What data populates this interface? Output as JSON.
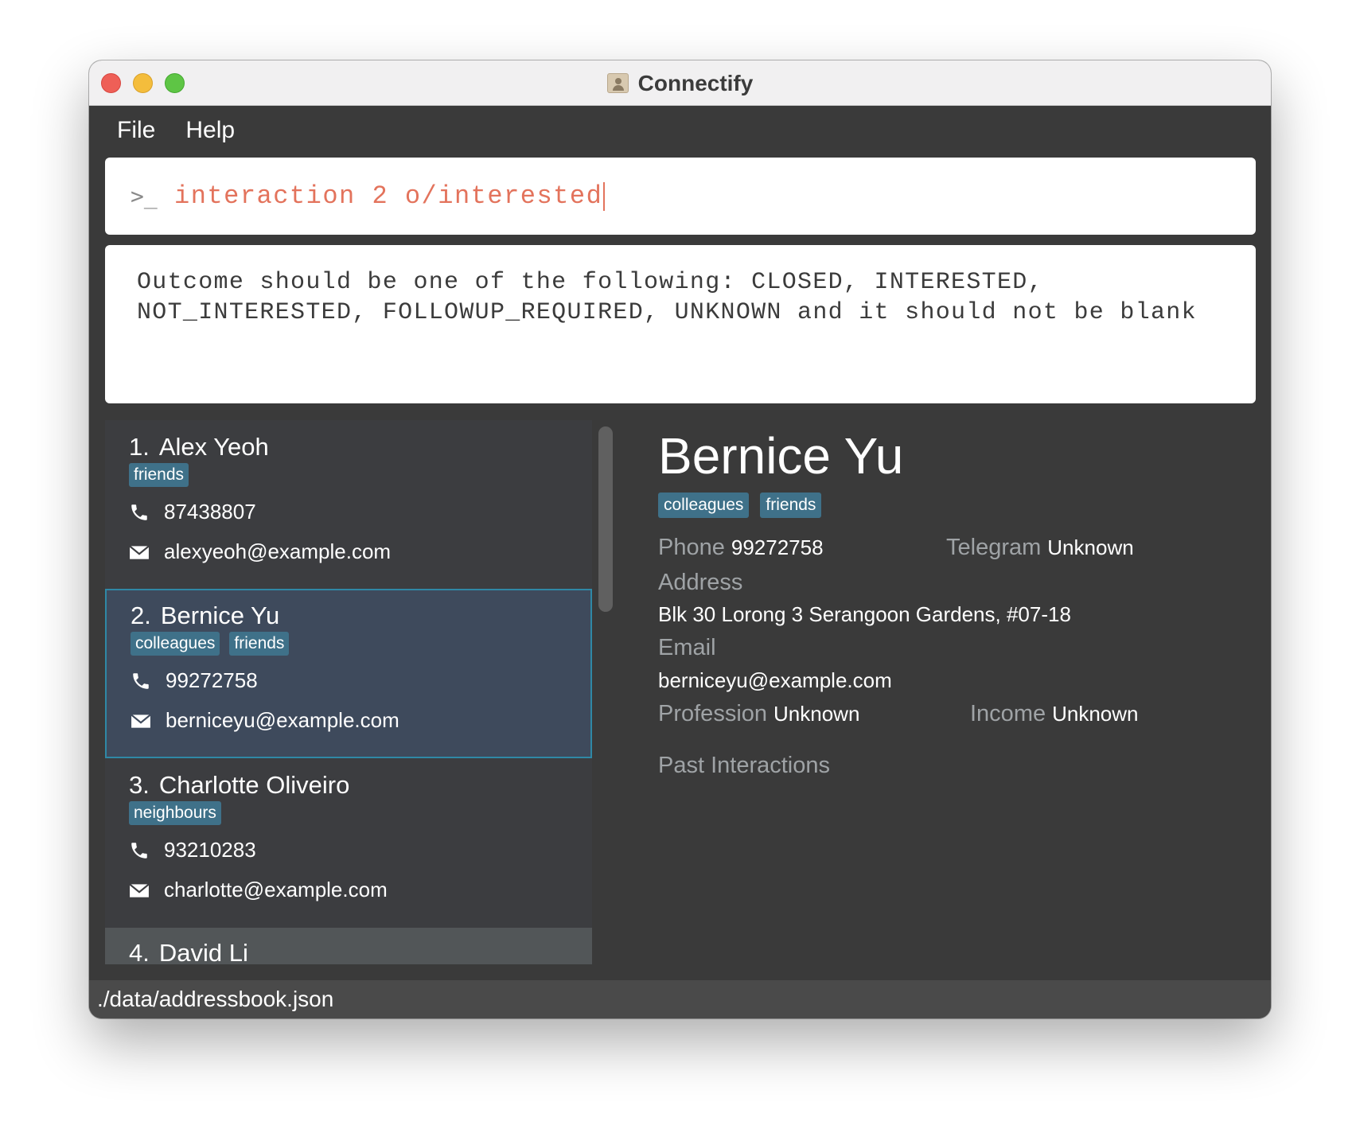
{
  "window": {
    "title": "Connectify"
  },
  "menu": {
    "file": "File",
    "help": "Help"
  },
  "command": {
    "prompt_icon": ">_",
    "value": "interaction 2 o/interested"
  },
  "result": {
    "message": "Outcome should be one of the following: CLOSED, INTERESTED,\nNOT_INTERESTED, FOLLOWUP_REQUIRED, UNKNOWN and it should not be blank"
  },
  "persons": [
    {
      "index": "1.",
      "name": "Alex Yeoh",
      "tags": [
        "friends"
      ],
      "phone": "87438807",
      "email": "alexyeoh@example.com"
    },
    {
      "index": "2.",
      "name": "Bernice Yu",
      "tags": [
        "colleagues",
        "friends"
      ],
      "phone": "99272758",
      "email": "berniceyu@example.com"
    },
    {
      "index": "3.",
      "name": "Charlotte Oliveiro",
      "tags": [
        "neighbours"
      ],
      "phone": "93210283",
      "email": "charlotte@example.com"
    },
    {
      "index": "4.",
      "name": "David Li"
    }
  ],
  "detail": {
    "name": "Bernice Yu",
    "tags": [
      "colleagues",
      "friends"
    ],
    "phone_label": "Phone",
    "phone": "99272758",
    "telegram_label": "Telegram",
    "telegram": "Unknown",
    "address_label": "Address",
    "address": "Blk 30 Lorong 3 Serangoon Gardens, #07-18",
    "email_label": "Email",
    "email": "berniceyu@example.com",
    "profession_label": "Profession",
    "profession": "Unknown",
    "income_label": "Income",
    "income": "Unknown",
    "interactions_label": "Past Interactions"
  },
  "status": {
    "file_path": "./data/addressbook.json"
  },
  "colors": {
    "accent": "#2f88a6",
    "tag": "#3f7189",
    "command_text": "#e3735c"
  }
}
